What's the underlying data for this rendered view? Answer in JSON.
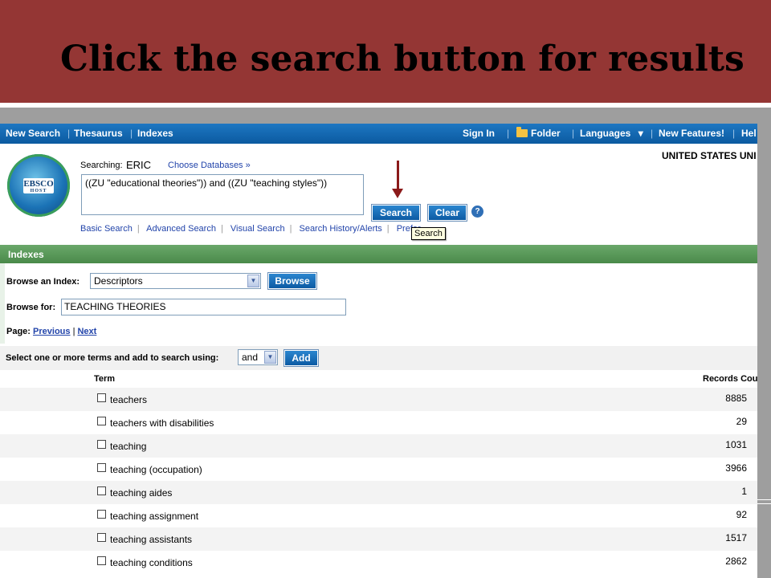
{
  "slide": {
    "title": "Click the search button for results"
  },
  "topnav": {
    "new_search": "New Search",
    "thesaurus": "Thesaurus",
    "indexes": "Indexes",
    "sign_in": "Sign In",
    "folder": "Folder",
    "languages": "Languages",
    "languages_caret": "▾",
    "new_features": "New Features!",
    "help": "Hel"
  },
  "logo": {
    "line1": "EBSCO",
    "line2": "HOST"
  },
  "search": {
    "searching_label": "Searching:",
    "database": "ERIC",
    "choose_databases": "Choose Databases »",
    "institution": "UNITED STATES UNI",
    "query": "((ZU \"educational theories\"))  and  ((ZU \"teaching styles\"))",
    "search_button": "Search",
    "clear_button": "Clear",
    "help_icon": "?",
    "tooltip": "Search"
  },
  "links": [
    "Basic Search",
    "Advanced Search",
    "Visual Search",
    "Search History/Alerts",
    "Prefer"
  ],
  "indexes_panel": {
    "title": "Indexes",
    "browse_index_label": "Browse an Index:",
    "browse_index_value": "Descriptors",
    "browse_button": "Browse",
    "browse_for_label": "Browse for:",
    "browse_for_value": "TEACHING THEORIES",
    "page_label": "Page:",
    "previous": "Previous",
    "next": "Next",
    "select_terms_label": "Select one or more terms and add to search using:",
    "operator_value": "and",
    "add_button": "Add"
  },
  "table": {
    "headers": {
      "term": "Term",
      "records": "Records Cou"
    },
    "rows": [
      {
        "term": "teachers",
        "count": "8885"
      },
      {
        "term": "teachers with disabilities",
        "count": "29"
      },
      {
        "term": "teaching",
        "count": "1031"
      },
      {
        "term": "teaching (occupation)",
        "count": "3966"
      },
      {
        "term": "teaching aides",
        "count": "1"
      },
      {
        "term": "teaching assignment",
        "count": "92"
      },
      {
        "term": "teaching assistants",
        "count": "1517"
      },
      {
        "term": "teaching conditions",
        "count": "2862"
      }
    ]
  },
  "colors": {
    "slide_header": "#943634",
    "nav_blue": "#1e77c2",
    "indexes_green": "#5a9a5a",
    "arrow": "#8b1a1a",
    "link": "#2244aa"
  }
}
